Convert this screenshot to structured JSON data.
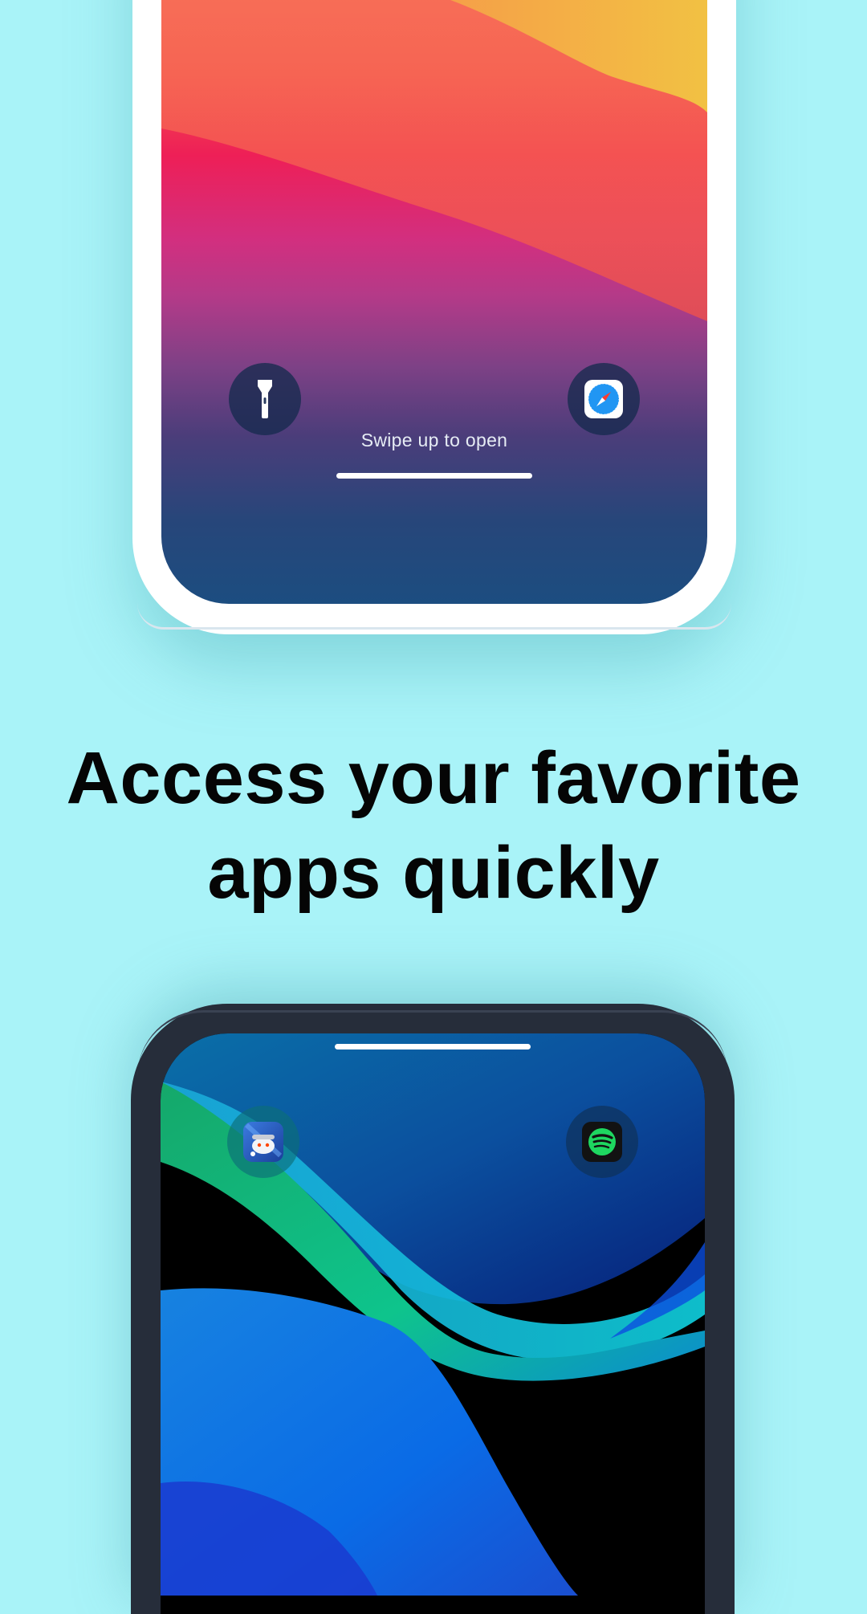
{
  "headline": {
    "line1": "Access your favorite",
    "line2": "apps quickly"
  },
  "top_phone": {
    "swipe_label": "Swipe up to open",
    "left_shortcut_icon": "flashlight-icon",
    "right_shortcut_icon": "safari-compass-icon"
  },
  "bottom_phone": {
    "left_shortcut_icon": "reddit-app-icon",
    "right_shortcut_icon": "spotify-app-icon"
  },
  "colors": {
    "background": "#a9f3f8",
    "headline": "#050505",
    "top_phone_frame": "#ffffff",
    "bottom_phone_frame": "#262d3a",
    "spotify_green": "#1ed760"
  }
}
